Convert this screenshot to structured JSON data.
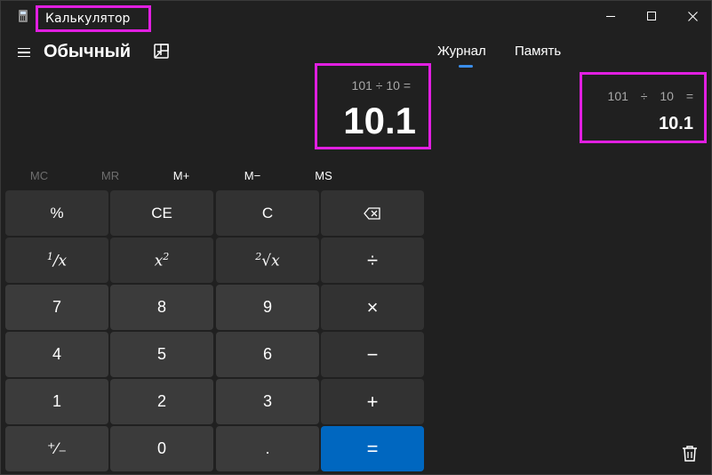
{
  "titlebar": {
    "title": "Калькулятор"
  },
  "header": {
    "mode": "Обычный",
    "tabs": [
      "Журнал",
      "Память"
    ]
  },
  "display": {
    "expression": "101 ÷ 10 =",
    "value": "10.1"
  },
  "history": {
    "expression": "101 ÷ 10 =",
    "result": "10.1"
  },
  "memory_row": [
    "MC",
    "MR",
    "M+",
    "M−",
    "MS"
  ],
  "keypad": {
    "percent": "%",
    "ce": "CE",
    "c": "C",
    "divide": "÷",
    "multiply": "×",
    "minus": "−",
    "plus": "+",
    "equals": "=",
    "seven": "7",
    "eight": "8",
    "nine": "9",
    "four": "4",
    "five": "5",
    "six": "6",
    "one": "1",
    "two": "2",
    "three": "3",
    "zero": "0",
    "dot": ".",
    "negate": "⁺∕₋"
  },
  "colors": {
    "background": "#202020",
    "accent": "#0067c0",
    "highlight": "#e11fe1",
    "tab_indicator": "#3b8eea"
  },
  "icons": [
    "calculator-app-icon",
    "minimize-icon",
    "maximize-icon",
    "close-icon",
    "menu-icon",
    "keep-on-top-icon",
    "backspace-icon",
    "trash-icon"
  ]
}
